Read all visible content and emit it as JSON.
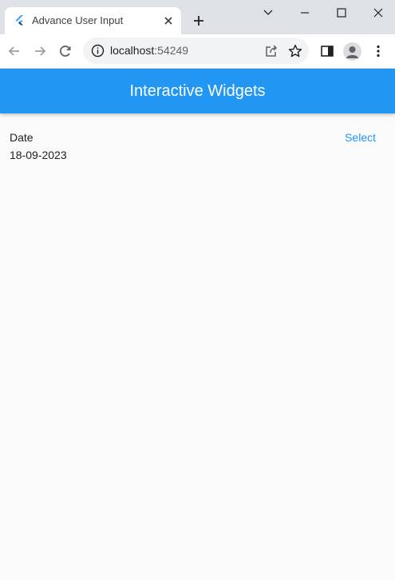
{
  "browser": {
    "tab": {
      "title": "Advance User Input",
      "favicon": "flutter-logo-icon",
      "close_icon": "close-icon"
    },
    "new_tab_icon": "plus-icon",
    "window_controls": [
      "chevron-down-icon",
      "minimize-icon",
      "maximize-icon",
      "close-icon"
    ],
    "toolbar": {
      "back_icon": "arrow-left-icon",
      "forward_icon": "arrow-right-icon",
      "reload_icon": "reload-icon",
      "url_host": "localhost",
      "url_port": ":54249",
      "share_icon": "share-icon",
      "bookmark_icon": "star-icon",
      "side_panel_icon": "side-panel-icon",
      "profile_icon": "person-icon",
      "menu_icon": "kebab-menu-icon"
    }
  },
  "app": {
    "appbar": {
      "title": "Interactive Widgets",
      "color": "#2196f3"
    },
    "date_field": {
      "label": "Date",
      "value": "18-09-2023",
      "select_label": "Select"
    }
  }
}
